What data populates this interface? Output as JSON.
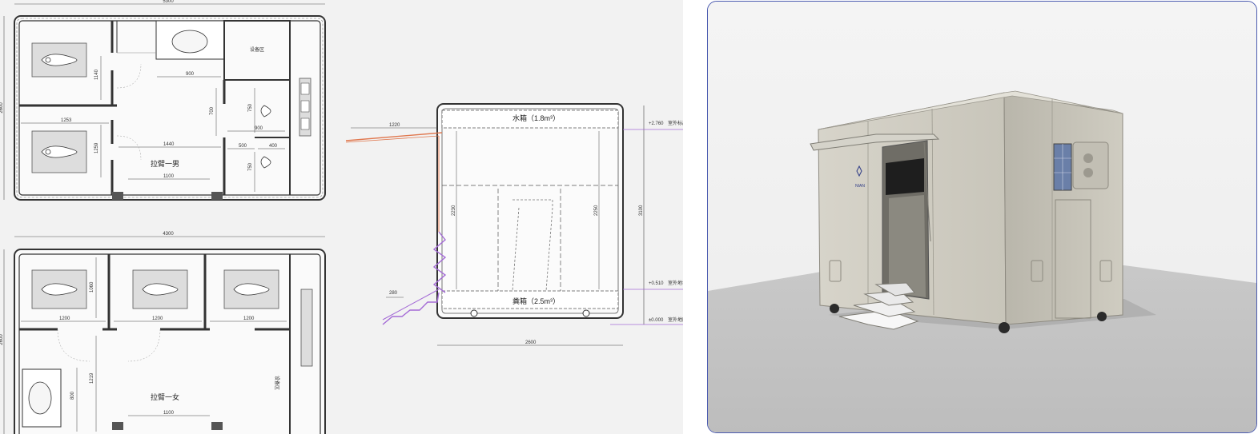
{
  "plan_top": {
    "overall_width": "5300",
    "overall_depth": "2600",
    "dims": [
      "900",
      "1140",
      "1253",
      "700",
      "750",
      "900",
      "500",
      "400",
      "750",
      "1440",
      "1100",
      "1259"
    ],
    "room_label": "拉臂一男",
    "equipment_label": "设备区"
  },
  "plan_bottom": {
    "overall_width": "4300",
    "overall_depth": "2600",
    "dims": [
      "1200",
      "1200",
      "1200",
      "1060",
      "1219",
      "800",
      "1100"
    ],
    "room_label": "拉臂一女",
    "equipment_label": "设备区"
  },
  "section": {
    "water_tank_label": "水箱（1.8m³）",
    "waste_tank_label": "粪箱（2.5m³）",
    "canopy_dim": "1220",
    "step_dim": "280",
    "height_inner_left": "2230",
    "height_inner_right": "2250",
    "height_total": "3100",
    "base_width": "2600",
    "levels": [
      {
        "value": "+2.760",
        "text": "室外标高"
      },
      {
        "value": "+0.510",
        "text": "室外地坪"
      },
      {
        "value": "±0.000",
        "text": "室外地面"
      }
    ]
  },
  "render": {
    "logo_text": "NIAN"
  },
  "colors": {
    "line": "#3a3a3a",
    "accent_purple": "#a46bd6",
    "accent_orange": "#e0784f",
    "frame_blue": "#4b5bb0",
    "cabin": "#c9c6bb"
  }
}
